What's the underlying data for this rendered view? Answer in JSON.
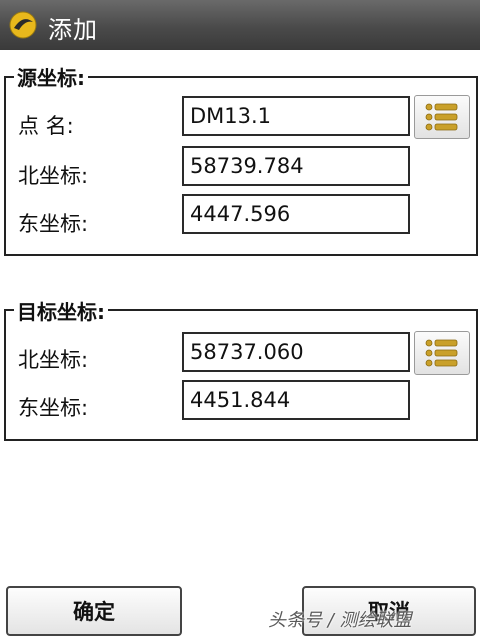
{
  "window": {
    "title": "添加",
    "icon": "app-logo-icon"
  },
  "source_group": {
    "legend": "源坐标",
    "point_name_label": "点 名:",
    "point_name_value": "DM13.1",
    "north_label": "北坐标:",
    "north_value": "58739.784",
    "east_label": "东坐标:",
    "east_value": "4447.596",
    "list_button_icon": "list-icon"
  },
  "target_group": {
    "legend": "目标坐标",
    "north_label": "北坐标:",
    "north_value": "58737.060",
    "east_label": "东坐标:",
    "east_value": "4451.844",
    "list_button_icon": "list-icon"
  },
  "buttons": {
    "ok": "确定",
    "cancel": "取消"
  },
  "watermark": "头条号 / 测绘联盟",
  "colors": {
    "titlebar": "#4a4a4a",
    "list_icon": "#c9a02a",
    "logo": "#e8b81c"
  }
}
